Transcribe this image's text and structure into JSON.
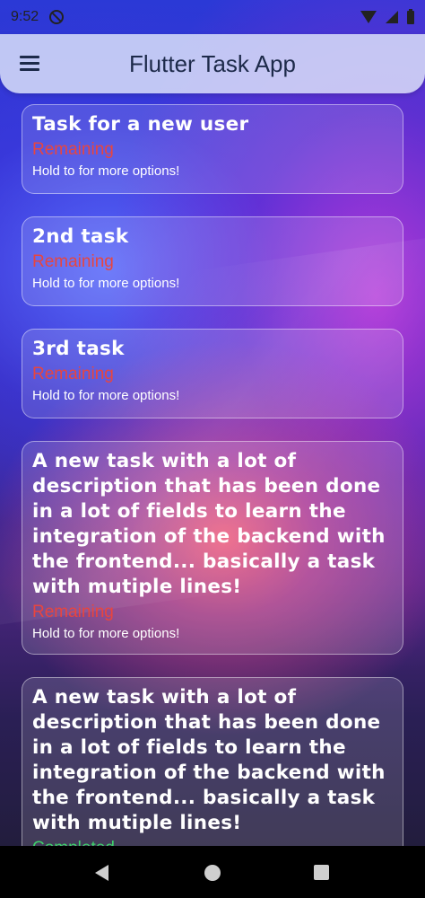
{
  "status_bar": {
    "time": "9:52"
  },
  "app_bar": {
    "title": "Flutter Task App"
  },
  "tasks": [
    {
      "title": "Task for a new user",
      "status": "Remaining",
      "hint": "Hold to for more options!"
    },
    {
      "title": "2nd task",
      "status": "Remaining",
      "hint": "Hold to for more options!"
    },
    {
      "title": "3rd task",
      "status": "Remaining",
      "hint": "Hold to for more options!"
    },
    {
      "title": "A new task with a lot of description that has been done in a lot of fields to learn the integration of the backend with the frontend... basically a task with mutiple lines!",
      "status": "Remaining",
      "hint": "Hold to for more options!"
    },
    {
      "title": "A new task with a lot of description that has been done in a lot of fields to learn the integration of the backend with the frontend... basically a task with mutiple lines!",
      "status": "Completed",
      "hint": ""
    }
  ],
  "colors": {
    "remaining": "#e8453f",
    "completed": "#3fd06b",
    "app_bar_text": "#1d2a4a"
  },
  "icons": {
    "menu": "menu-icon",
    "back": "back-icon",
    "home": "home-icon",
    "recents": "recents-icon"
  }
}
